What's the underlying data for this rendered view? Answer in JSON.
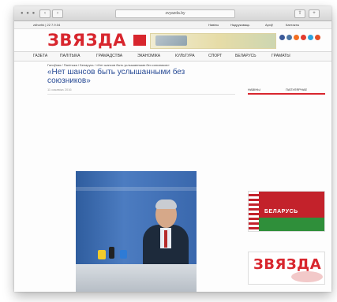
{
  "browser": {
    "url": "zvyazda.by",
    "back_label": "‹",
    "forward_label": "›",
    "share_label": "⇧",
    "add_tab_label": "+"
  },
  "topbar": {
    "left_text": "zdhorhk | 22 7.9.04",
    "items": [
      "Навіны",
      "Надрукаваць",
      "Архіў",
      "Кантакты"
    ]
  },
  "site": {
    "logo_text": "ЗВЯЗДА",
    "banner_text": "",
    "social_colors": [
      "#3b5998",
      "#4c75a3",
      "#f36f21",
      "#e23b2e",
      "#2ea3dd",
      "#e34f26"
    ]
  },
  "nav": {
    "items": [
      "ГАЗЕТА",
      "ПАЛІТЫКА",
      "ГРАМАДСТВА",
      "ЭКАНОМІКА",
      "КУЛЬТУРА",
      "СПОРТ",
      "БЕЛАРУСЬ",
      "ГРАМАТЫ"
    ]
  },
  "article": {
    "breadcrumb": "Галоўная / Палітыка / Беларусь / «Нет шансов быть услышанными без союзников»",
    "title": "«Нет шансов быть услышанными без союзников»",
    "meta_date": "11 сакавіка 2016",
    "meta_author": "",
    "meta_views": "",
    "paragraph": "",
    "caption": ""
  },
  "sidebar": {
    "tab_news": "НАВІНЫ",
    "tab_popular": "ПАПУЛЯРНАЕ",
    "news": [
      {
        "time": "",
        "text": ""
      },
      {
        "time": "",
        "text": ""
      },
      {
        "time": "",
        "text": ""
      },
      {
        "time": "",
        "text": ""
      },
      {
        "time": "",
        "text": ""
      },
      {
        "time": "",
        "text": ""
      },
      {
        "time": "",
        "text": ""
      }
    ],
    "flag_banner_text": "БЕЛАРУСЬ",
    "ad_logo_text": "ЗВЯЗДА"
  }
}
